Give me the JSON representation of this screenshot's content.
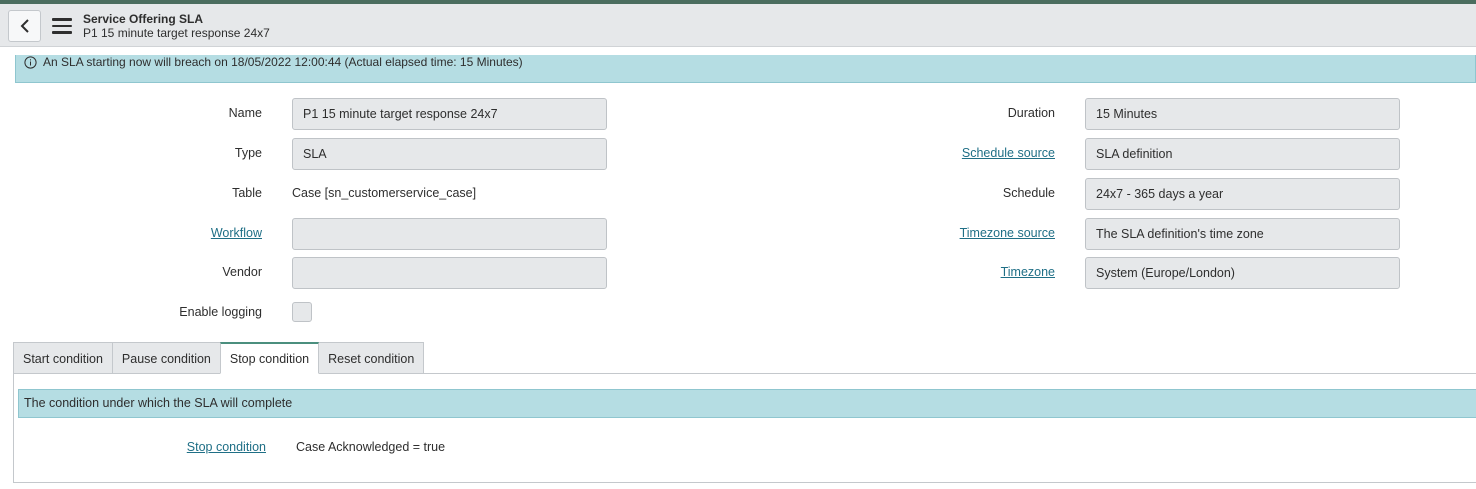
{
  "header": {
    "title": "Service Offering SLA",
    "subtitle": "P1 15 minute target response 24x7"
  },
  "banner": {
    "message": "An SLA starting now will breach on 18/05/2022 12:00:44 (Actual elapsed time: 15 Minutes)"
  },
  "form": {
    "name_label": "Name",
    "name_value": "P1 15 minute target response 24x7",
    "type_label": "Type",
    "type_value": "SLA",
    "table_label": "Table",
    "table_value": "Case [sn_customerservice_case]",
    "workflow_label": "Workflow",
    "workflow_value": "",
    "vendor_label": "Vendor",
    "vendor_value": "",
    "enable_logging_label": "Enable logging",
    "duration_label": "Duration",
    "duration_value": "15 Minutes",
    "schedule_source_label": "Schedule source",
    "schedule_source_value": "SLA definition",
    "schedule_label": "Schedule",
    "schedule_value": "24x7 - 365 days a year",
    "timezone_source_label": "Timezone source",
    "timezone_source_value": "The SLA definition's time zone",
    "timezone_label": "Timezone",
    "timezone_value": "System (Europe/London)"
  },
  "tabs": [
    {
      "label": "Start condition",
      "active": false
    },
    {
      "label": "Pause condition",
      "active": false
    },
    {
      "label": "Stop condition",
      "active": true
    },
    {
      "label": "Reset condition",
      "active": false
    }
  ],
  "stop_panel": {
    "banner": "The condition under which the SLA will complete",
    "condition_label": "Stop condition",
    "condition_value": "Case Acknowledged = true"
  },
  "colors": {
    "accent": "#4b8f7e",
    "link": "#1f6f86",
    "info_banner": "#b5dde3",
    "field_bg": "#e6e8ea"
  }
}
